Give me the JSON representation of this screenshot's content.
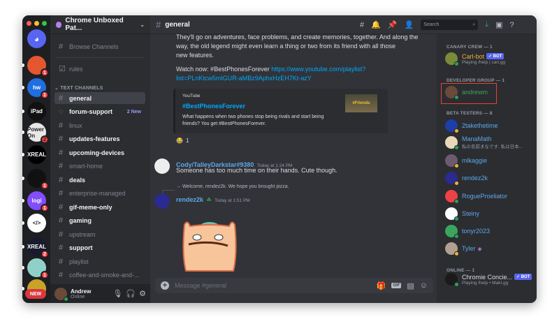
{
  "window": {
    "controls": [
      "close",
      "minimize",
      "zoom"
    ]
  },
  "servers": [
    {
      "label": "",
      "color": "#5865f2",
      "badge": "",
      "icon": "discord-home-icon"
    },
    {
      "label": "",
      "color": "#e2572f",
      "badge": "1"
    },
    {
      "label": "hw",
      "color": "#1f6fe0",
      "badge": "1"
    },
    {
      "label": "iPad",
      "color": "#111",
      "badge": ""
    },
    {
      "label": "Power On",
      "color": "#e8e8e8",
      "badge": "2"
    },
    {
      "label": "XREAL",
      "color": "#000",
      "badge": ""
    },
    {
      "label": "",
      "color": "#111",
      "badge": "1"
    },
    {
      "label": "logi",
      "color": "#814efa",
      "badge": "1"
    },
    {
      "label": "</>",
      "color": "#fff",
      "badge": ""
    },
    {
      "label": "XREAL",
      "color": "#1a1a2e",
      "badge": "2"
    },
    {
      "label": "",
      "color": "#8fd1c8",
      "badge": "1"
    },
    {
      "label": "",
      "color": "#c9a227",
      "badge": ""
    }
  ],
  "new_label": "NEW",
  "guild": {
    "name": "Chrome Unboxed Pat..."
  },
  "sidebar": {
    "browse": "Browse Channels",
    "rules": "rules",
    "category": "TEXT CHANNELS",
    "channels": [
      {
        "name": "general",
        "state": "sel"
      },
      {
        "name": "forum-support",
        "state": "unread",
        "tag": "2 New",
        "type": "forum"
      },
      {
        "name": "linux",
        "state": ""
      },
      {
        "name": "updates-features",
        "state": "unread"
      },
      {
        "name": "upcoming-devices",
        "state": "unread"
      },
      {
        "name": "smart-home",
        "state": ""
      },
      {
        "name": "deals",
        "state": "unread"
      },
      {
        "name": "enterprise-managed",
        "state": ""
      },
      {
        "name": "gif-meme-only",
        "state": "unread"
      },
      {
        "name": "gaming",
        "state": "unread"
      },
      {
        "name": "upstream",
        "state": ""
      },
      {
        "name": "support",
        "state": "unread"
      },
      {
        "name": "playlist",
        "state": ""
      },
      {
        "name": "coffee-and-smoke-and-...",
        "state": ""
      }
    ]
  },
  "user": {
    "name": "Andrew",
    "status": "Online"
  },
  "header": {
    "channel": "general",
    "search_placeholder": "Search"
  },
  "messages": {
    "body_lines": [
      "They'll go on adventures, face problems, and create memories, together. And along the",
      "way, the old legend might even learn a thing or two from its friend with all those",
      "new features."
    ],
    "watch": "Watch now: #BestPhonesForever",
    "link1": "https://www.youtube.com/playlist?",
    "link2": "list=PLnKtcw5mIGUR-aMBz9AphxHzEH7Kt-azY",
    "embed": {
      "provider": "YouTube",
      "title": "#BestPhonesForever",
      "desc1": "What happens when two phones stop being rivals and start being",
      "desc2": "friends? You get #BestPhonesForever.",
      "thumb_text": "#Friends"
    },
    "reaction": {
      "emoji": "😂",
      "count": "1"
    },
    "cody": {
      "name": "Cody/TalleyDarkstar#9380",
      "time": "Today at 1:24 PM",
      "text": "Someone has too much time on their hands.  Cute though."
    },
    "reply": "→ Welcome, rendez2k. We hope you brought pizza.",
    "rendez": {
      "name": "rendez2k",
      "time": "Today at 1:51 PM"
    }
  },
  "input": {
    "placeholder": "Message #general",
    "gif": "GIF"
  },
  "members": {
    "groups": [
      {
        "title": "CANARY CREW — 1"
      },
      {
        "title": "DEVELOPER GROUP — 1"
      },
      {
        "title": "BETA TESTERS — 8"
      },
      {
        "title": "ONLINE — 1"
      }
    ],
    "list": [
      {
        "name": "Carl-bot",
        "sub": "Playing /help | carl.gg",
        "bot": "✓ BOT",
        "color": "#f0b232",
        "av": "#7a8a3a",
        "st": "#23a55a"
      },
      {
        "name": "andrewm",
        "color": "#3ba55c",
        "av": "#6b4a3a",
        "st": "#23a55a",
        "highlight": true
      },
      {
        "name": "2takethetime",
        "color": "#5ea8e8",
        "av": "#1d3ea8",
        "st": "#f0b232"
      },
      {
        "name": "ManaMath",
        "sub": "私の名前まなです. 私は日本...",
        "color": "#5ea8e8",
        "av": "#e8d8b8",
        "st": "#23a55a"
      },
      {
        "name": "mlkaggie",
        "color": "#5ea8e8",
        "av": "#6b5a70",
        "st": "#f0b232"
      },
      {
        "name": "rendez2k",
        "color": "#5ea8e8",
        "av": "#2a2a90",
        "st": "#f0b232"
      },
      {
        "name": "RogueProeliator",
        "color": "#5ea8e8",
        "av": "#ed4245",
        "st": "#23a55a"
      },
      {
        "name": "Steiny",
        "color": "#5ea8e8",
        "av": "#ffffff",
        "st": "#23a55a"
      },
      {
        "name": "tonyr2023",
        "color": "#5ea8e8",
        "av": "#3ba55c",
        "st": "#23a55a"
      },
      {
        "name": "Tyler",
        "color": "#5ea8e8",
        "av": "#b0a090",
        "st": "#f0b232",
        "nitro": "◈"
      },
      {
        "name": "Chromie Concie...",
        "sub": "Playing /help • MakI.gg",
        "bot": "✓ BOT",
        "color": "#dbdee1",
        "av": "#1a1a1a",
        "st": "#23a55a"
      }
    ]
  }
}
